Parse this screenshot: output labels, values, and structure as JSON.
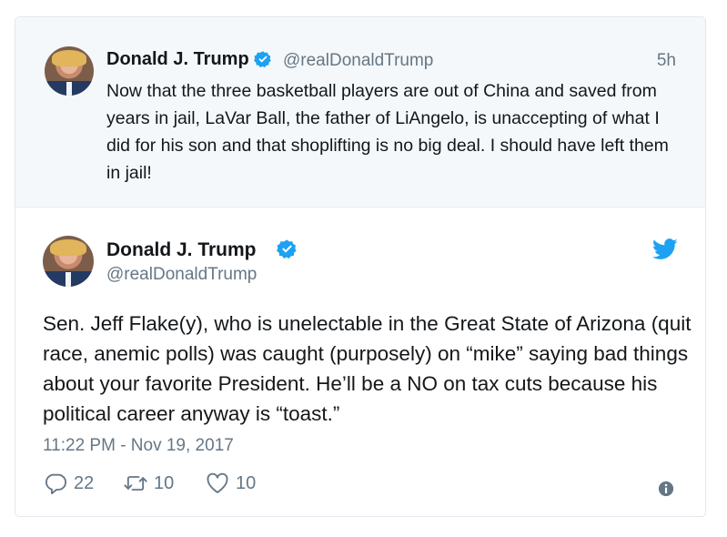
{
  "parent_tweet": {
    "display_name": "Donald J. Trump",
    "handle": "@realDonaldTrump",
    "time": "5h",
    "text": "Now that the three basketball players are out of China and saved from years in jail, LaVar Ball, the father of LiAngelo, is unaccepting of what I did for his son and that shoplifting is no big deal. I should have left them in jail!"
  },
  "main_tweet": {
    "display_name": "Donald J. Trump",
    "handle": "@realDonaldTrump",
    "text": "Sen. Jeff Flake(y), who is unelectable in the Great State of Arizona (quit race, anemic polls) was caught (purposely) on “mike” saying bad things about your favorite President. He’ll be a NO on tax cuts because his political career anyway is “toast.”",
    "date": "11:22 PM - Nov 19, 2017",
    "replies": "22",
    "retweets": "10",
    "likes": "10"
  },
  "icons": {
    "verified": "verified-badge-icon",
    "brand": "twitter-bird-icon",
    "reply": "reply-icon",
    "retweet": "retweet-icon",
    "like": "heart-icon",
    "info": "info-icon"
  },
  "colors": {
    "accent": "#1da1f2",
    "secondary_text": "#657786",
    "parent_background": "#f5f8fa"
  }
}
